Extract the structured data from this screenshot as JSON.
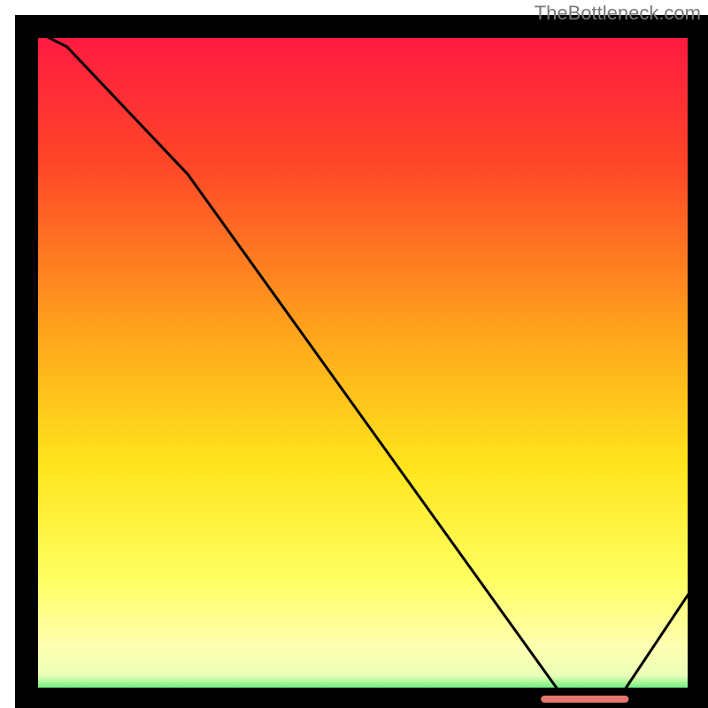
{
  "attribution": "TheBottleneck.com",
  "chart_data": {
    "type": "line",
    "title": "",
    "xlabel": "",
    "ylabel": "",
    "xlim": [
      0,
      100
    ],
    "ylim": [
      0,
      100
    ],
    "x": [
      0,
      6,
      24,
      80,
      88,
      100
    ],
    "values": [
      100,
      97,
      78,
      0,
      0,
      18
    ],
    "trough_band": {
      "x_start": 77,
      "x_end": 89,
      "y": 0
    },
    "gradient_stops": [
      {
        "offset": 0.0,
        "color": "#ff1744"
      },
      {
        "offset": 0.2,
        "color": "#ff4528"
      },
      {
        "offset": 0.45,
        "color": "#ffa21c"
      },
      {
        "offset": 0.65,
        "color": "#ffe41c"
      },
      {
        "offset": 0.82,
        "color": "#ffff60"
      },
      {
        "offset": 0.92,
        "color": "#ffffb0"
      },
      {
        "offset": 0.965,
        "color": "#eaffb8"
      },
      {
        "offset": 1.0,
        "color": "#00e050"
      }
    ],
    "frame_color": "#000000",
    "line_color": "#000000",
    "band_color": "#e5746b"
  }
}
